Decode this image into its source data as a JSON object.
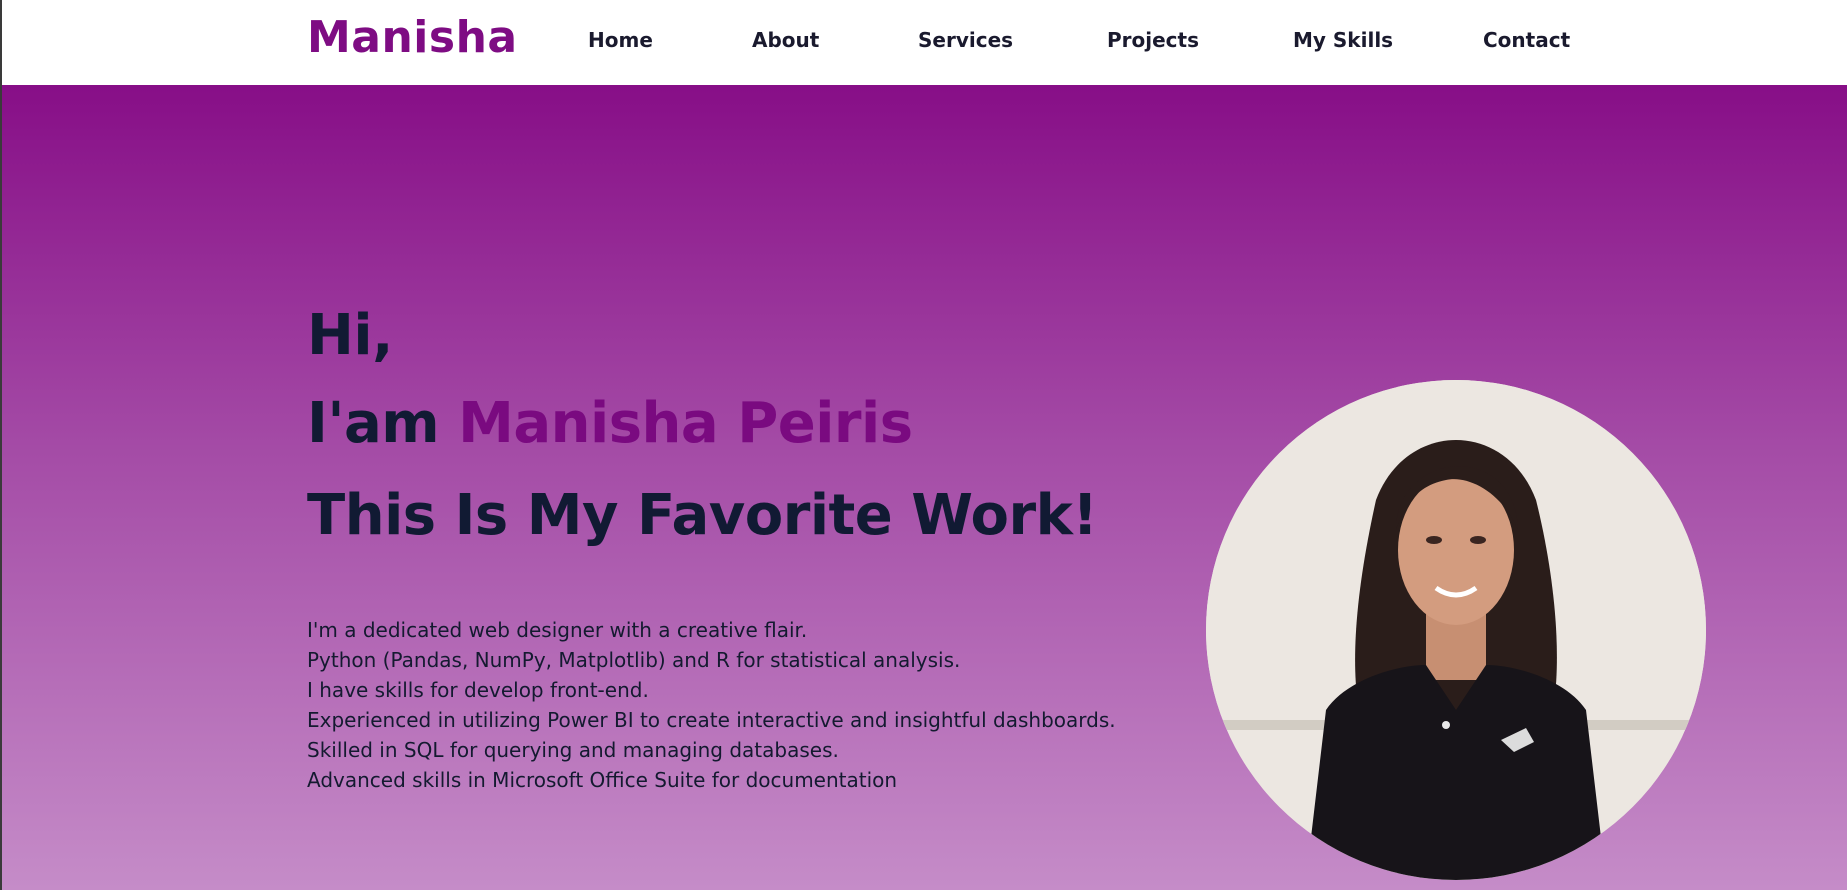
{
  "brand": {
    "logo_text": "Manisha"
  },
  "nav": {
    "items": [
      {
        "label": "Home"
      },
      {
        "label": "About"
      },
      {
        "label": "Services"
      },
      {
        "label": "Projects"
      },
      {
        "label": "My Skills"
      },
      {
        "label": "Contact"
      }
    ]
  },
  "hero": {
    "line1": "Hi,",
    "line2_prefix": "I'am ",
    "line2_name": "Manisha Peiris",
    "line3": "This Is My Favorite Work!",
    "description": [
      "I'm a dedicated web designer with a creative flair.",
      "Python (Pandas, NumPy, Matplotlib) and R for statistical analysis.",
      "I have skills for develop front-end.",
      "Experienced in utilizing Power BI to create interactive and insightful dashboards.",
      "Skilled in SQL for querying and managing databases.",
      "Advanced skills in Microsoft Office Suite for documentation"
    ]
  },
  "colors": {
    "brand": "#7e0c83",
    "gradient_top": "#870e87",
    "gradient_bottom": "#c58cc8",
    "heading": "#111a33"
  },
  "icons": {
    "profile_photo": "profile-photo"
  }
}
